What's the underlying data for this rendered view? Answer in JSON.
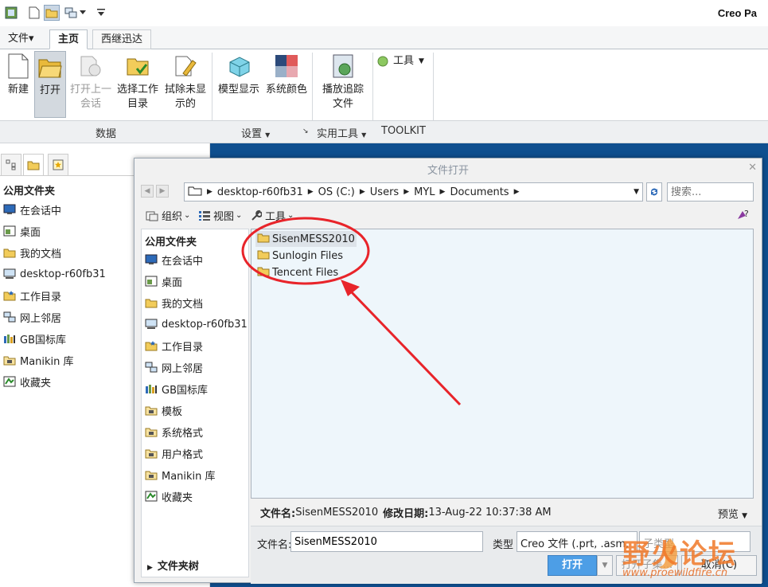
{
  "app": {
    "title": "Creo Pa"
  },
  "tabs": [
    {
      "label": "文件▾"
    },
    {
      "label": "主页"
    },
    {
      "label": "西继迅达"
    }
  ],
  "ribbon": {
    "buttons": [
      {
        "label": "新建"
      },
      {
        "label": "打开"
      },
      {
        "line1": "打开上一",
        "line2": "会话"
      },
      {
        "line1": "选择工作",
        "line2": "目录"
      },
      {
        "line1": "拭除未显",
        "line2": "示的"
      },
      {
        "label": "模型显示"
      },
      {
        "label": "系统颜色"
      },
      {
        "line1": "播放追踪",
        "line2": "文件"
      }
    ],
    "tools_label": "工具"
  },
  "groups": {
    "data": "数据",
    "settings": "设置",
    "util": "实用工具",
    "toolkit": "TOOLKIT"
  },
  "left": {
    "header": "公用文件夹",
    "items": [
      "在会话中",
      "桌面",
      "我的文档",
      "desktop-r60fb31",
      "工作目录",
      "网上邻居",
      "GB国标库",
      "Manikin 库",
      "收藏夹"
    ]
  },
  "dialog": {
    "title": "文件打开",
    "address": [
      "desktop-r60fb31",
      "OS (C:)",
      "Users",
      "MYL",
      "Documents"
    ],
    "search_placeholder": "搜索...",
    "toolbar": {
      "organize": "组织",
      "views": "视图",
      "tools": "工具"
    },
    "left_header": "公用文件夹",
    "left_items": [
      "在会话中",
      "桌面",
      "我的文档",
      "desktop-r60fb31",
      "工作目录",
      "网上邻居",
      "GB国标库",
      "模板",
      "系统格式",
      "用户格式",
      "Manikin 库",
      "收藏夹"
    ],
    "folders": [
      "SisenMESS2010",
      "Sunlogin Files",
      "Tencent Files"
    ],
    "info": {
      "name_label": "文件名:",
      "name_value": "SisenMESS2010",
      "date_label": "修改日期:",
      "date_value": "13-Aug-22 10:37:38 AM"
    },
    "preview": "预览",
    "filename_label": "文件名:",
    "filename_value": "SisenMESS2010",
    "type_label": "类型",
    "type_value": "Creo 文件 (.prt, .asm,",
    "subtype": "子类型",
    "open_button": "打开",
    "open_set": "打开子集...",
    "cancel": "取消(C)",
    "folder_tree": "文件夹树"
  },
  "watermark": {
    "text": "野火论坛",
    "url": "www.proewildfire.cn"
  },
  "colors": {
    "annotation": "#e8242a",
    "accent": "#4d9ee6",
    "workspace": "#0f4f8f"
  }
}
